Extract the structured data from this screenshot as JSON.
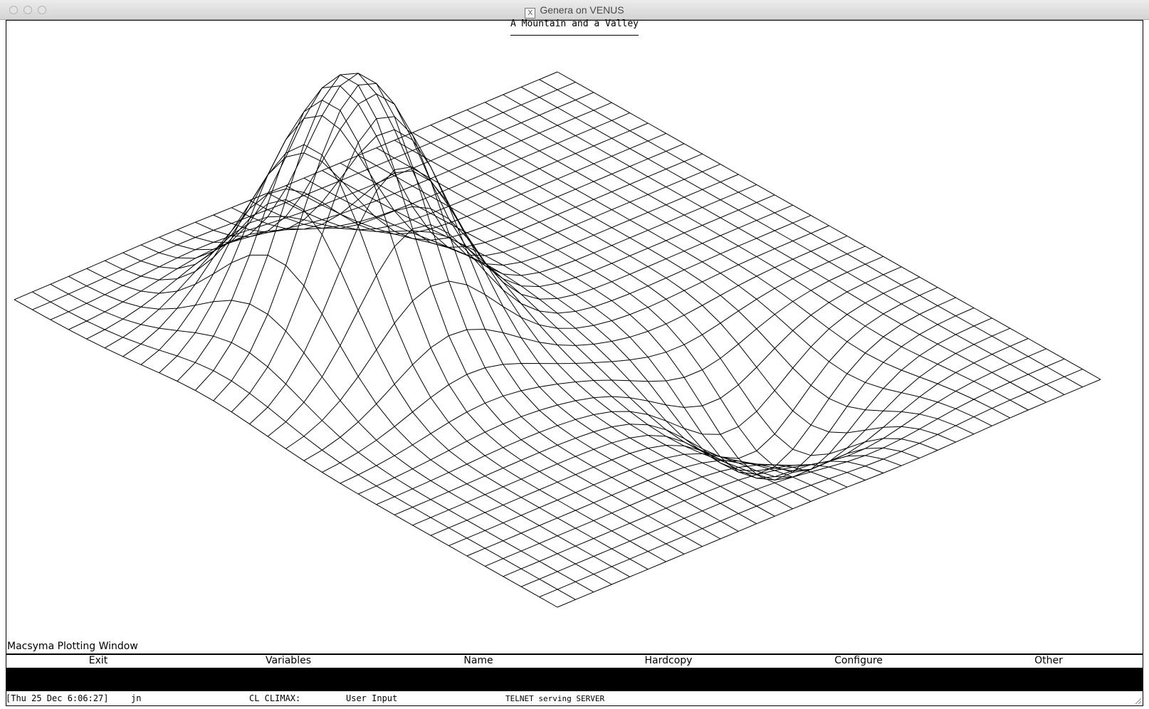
{
  "window": {
    "title": "Genera on VENUS",
    "x_icon": "X"
  },
  "plot": {
    "title": "A Mountain and a Valley",
    "pane_label": "Macsyma Plotting Window"
  },
  "menu": [
    "Exit",
    "Variables",
    "Name",
    "Hardcopy",
    "Configure",
    "Other"
  ],
  "status": {
    "datetime": "[Thu 25 Dec 6:06:27]",
    "user": "jn",
    "package": "CL CLIMAX:",
    "state": "User Input",
    "server": "TELNET serving SERVER"
  },
  "surface": {
    "grid_size": 30,
    "x_range": [
      -1,
      1
    ],
    "y_range": [
      -1,
      1
    ],
    "peaks": [
      {
        "amplitude": 1.0,
        "center": [
          -0.3,
          -0.45
        ],
        "width": 0.22
      },
      {
        "amplitude": -0.35,
        "center": [
          0.47,
          0.3
        ],
        "width": 0.2
      }
    ],
    "line_color": "#000000"
  }
}
